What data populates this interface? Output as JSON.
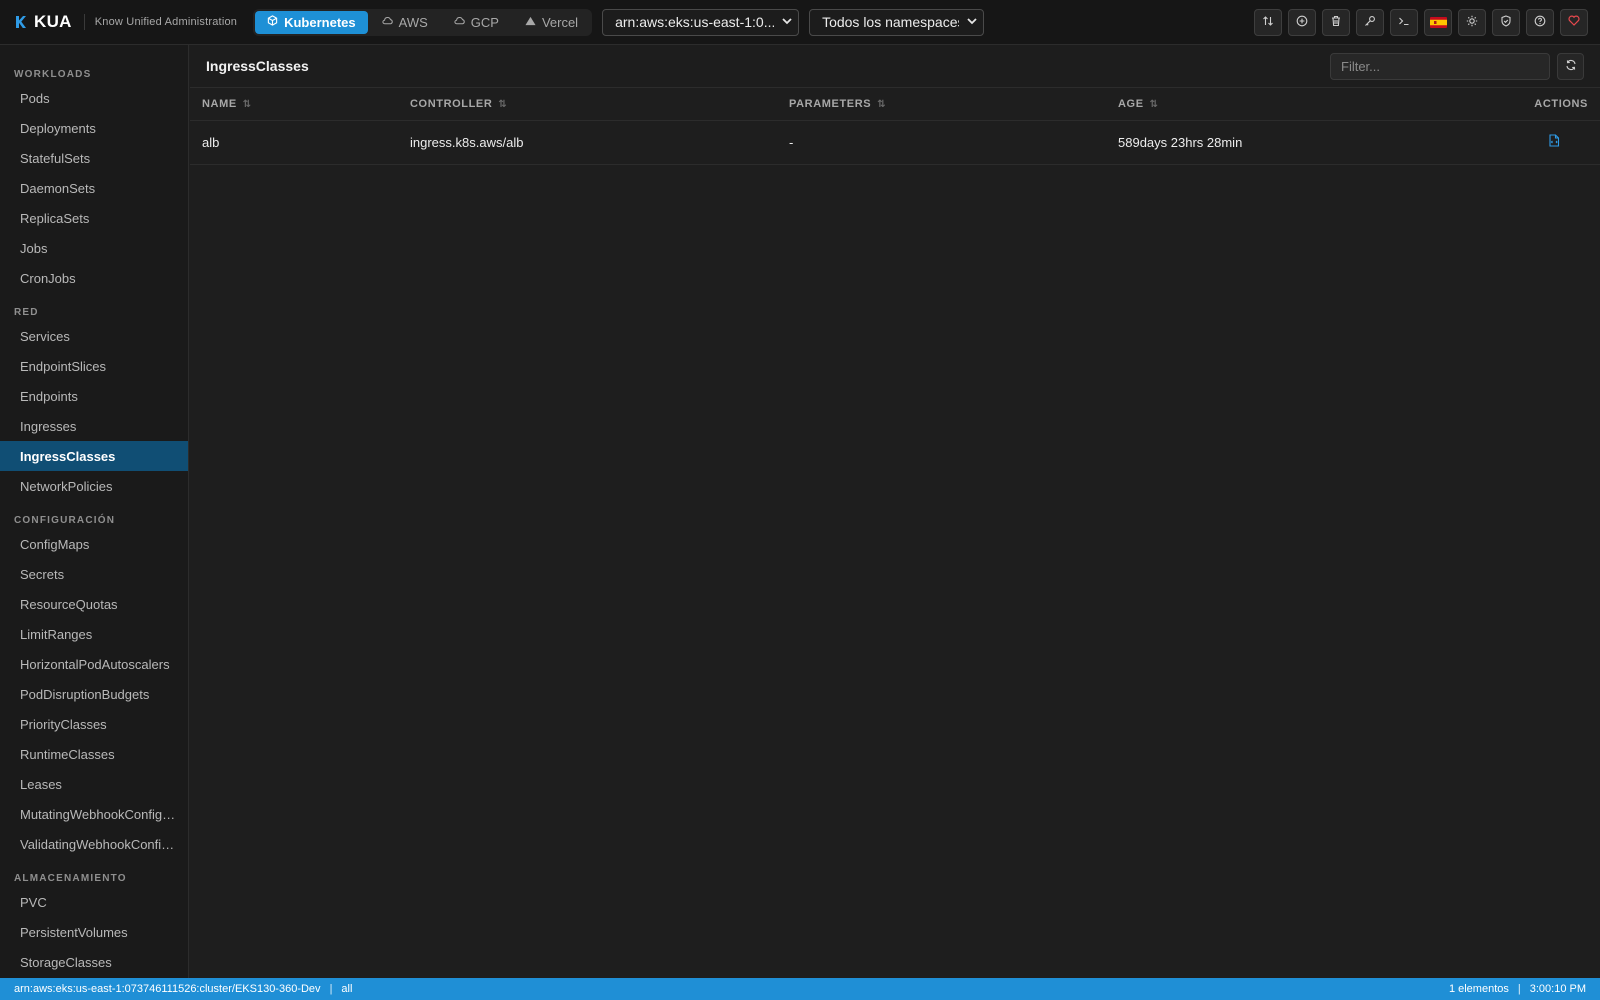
{
  "app": {
    "name": "KUA",
    "subtitle": "Know Unified Administration"
  },
  "providers": [
    {
      "label": "Kubernetes",
      "icon": "cube-icon",
      "active": true
    },
    {
      "label": "AWS",
      "icon": "cloud-icon",
      "active": false
    },
    {
      "label": "GCP",
      "icon": "cloud-icon",
      "active": false
    },
    {
      "label": "Vercel",
      "icon": "triangle-icon",
      "active": false
    }
  ],
  "cluster_select": {
    "value": "arn:aws:eks:us-east-1:0..."
  },
  "namespace_select": {
    "value": "Todos los namespaces"
  },
  "toolbar": [
    "port-forward-icon",
    "add-icon",
    "trash-icon",
    "key-icon",
    "terminal-icon",
    "spain-flag-icon",
    "sun-icon",
    "shield-icon",
    "help-icon",
    "heart-icon"
  ],
  "sidebar": {
    "sections": [
      {
        "title": "WORKLOADS",
        "items": [
          "Pods",
          "Deployments",
          "StatefulSets",
          "DaemonSets",
          "ReplicaSets",
          "Jobs",
          "CronJobs"
        ]
      },
      {
        "title": "RED",
        "items": [
          "Services",
          "EndpointSlices",
          "Endpoints",
          "Ingresses",
          "IngressClasses",
          "NetworkPolicies"
        ]
      },
      {
        "title": "CONFIGURACIÓN",
        "items": [
          "ConfigMaps",
          "Secrets",
          "ResourceQuotas",
          "LimitRanges",
          "HorizontalPodAutoscalers",
          "PodDisruptionBudgets",
          "PriorityClasses",
          "RuntimeClasses",
          "Leases",
          "MutatingWebhookConfigurations",
          "ValidatingWebhookConfigurations"
        ]
      },
      {
        "title": "ALMACENAMIENTO",
        "items": [
          "PVC",
          "PersistentVolumes",
          "StorageClasses"
        ]
      }
    ],
    "active_item": "IngressClasses"
  },
  "main": {
    "title": "IngressClasses",
    "filter_placeholder": "Filter...",
    "columns": [
      "NAME",
      "CONTROLLER",
      "PARAMETERS",
      "AGE",
      "ACTIONS"
    ],
    "rows": [
      {
        "name": "alb",
        "controller": "ingress.k8s.aws/alb",
        "parameters": "-",
        "age": "589days 23hrs 28min"
      }
    ]
  },
  "status": {
    "context": "arn:aws:eks:us-east-1:073746111526:cluster/EKS130-360-Dev",
    "namespace": "all",
    "count": "1 elementos",
    "time": "3:00:10 PM"
  },
  "colors": {
    "accent": "#1e90d6",
    "active_nav": "#104e74",
    "danger": "#e5484d"
  }
}
